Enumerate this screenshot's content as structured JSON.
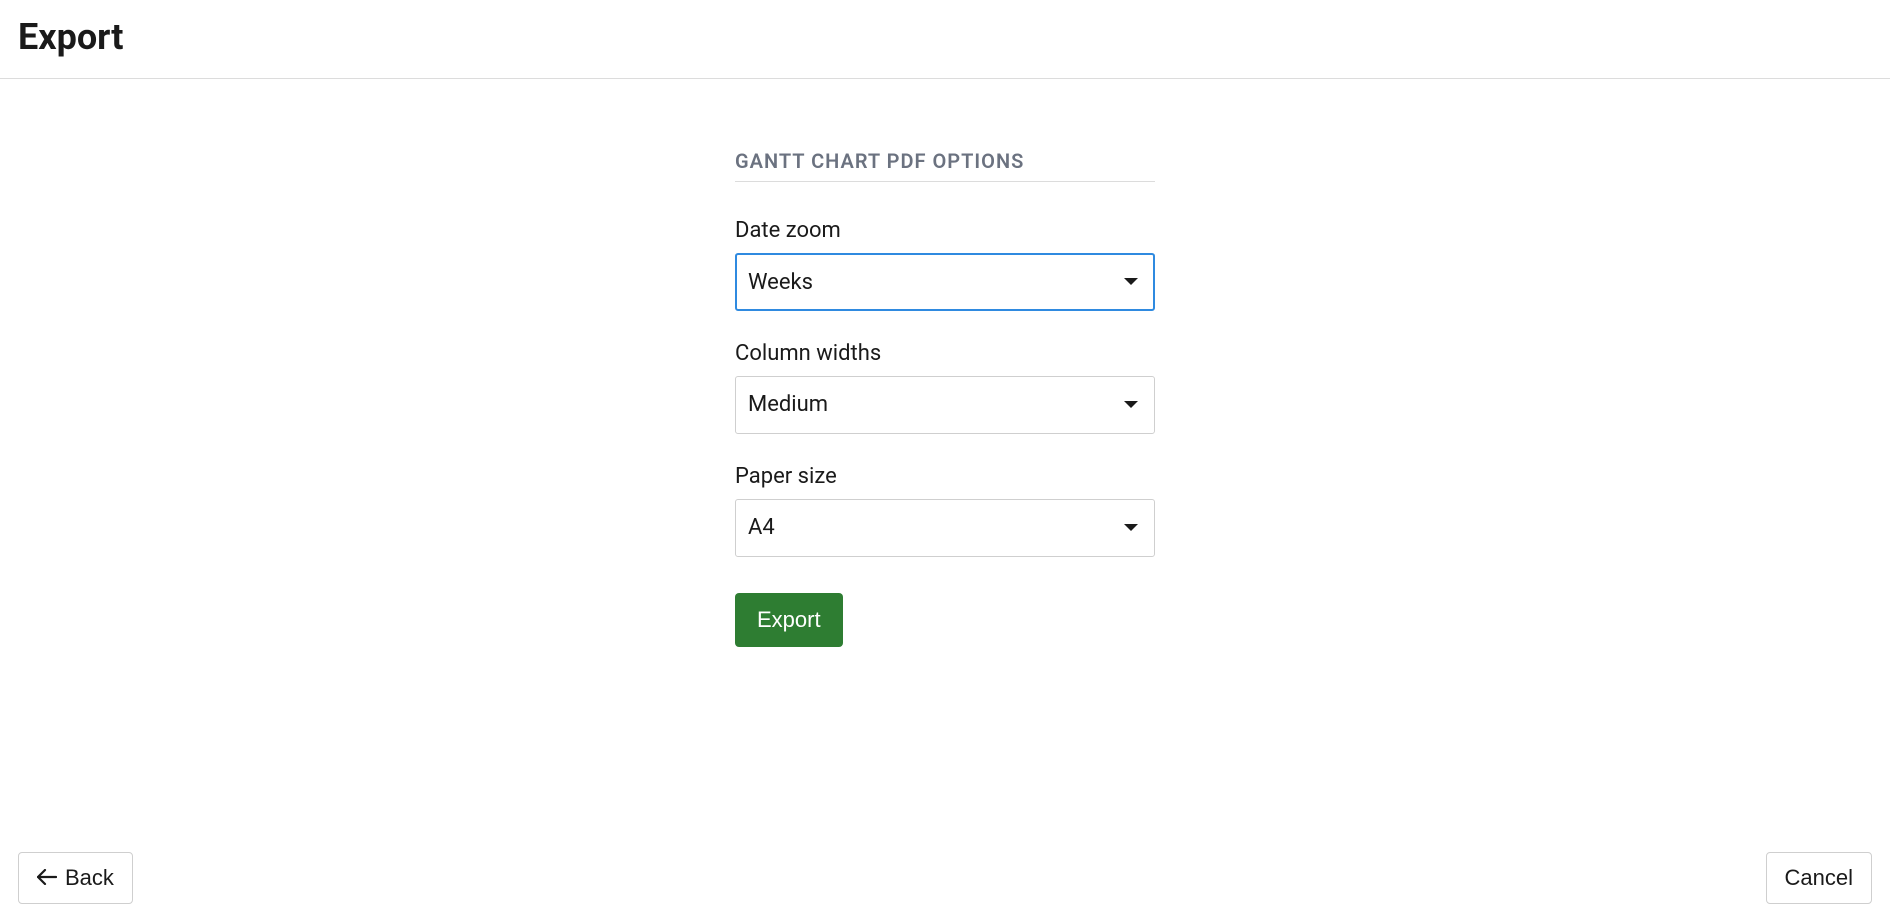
{
  "header": {
    "title": "Export"
  },
  "section": {
    "title": "GANTT CHART PDF OPTIONS"
  },
  "fields": {
    "date_zoom": {
      "label": "Date zoom",
      "value": "Weeks"
    },
    "column_widths": {
      "label": "Column widths",
      "value": "Medium"
    },
    "paper_size": {
      "label": "Paper size",
      "value": "A4"
    }
  },
  "buttons": {
    "export": "Export",
    "back": "Back",
    "cancel": "Cancel"
  }
}
